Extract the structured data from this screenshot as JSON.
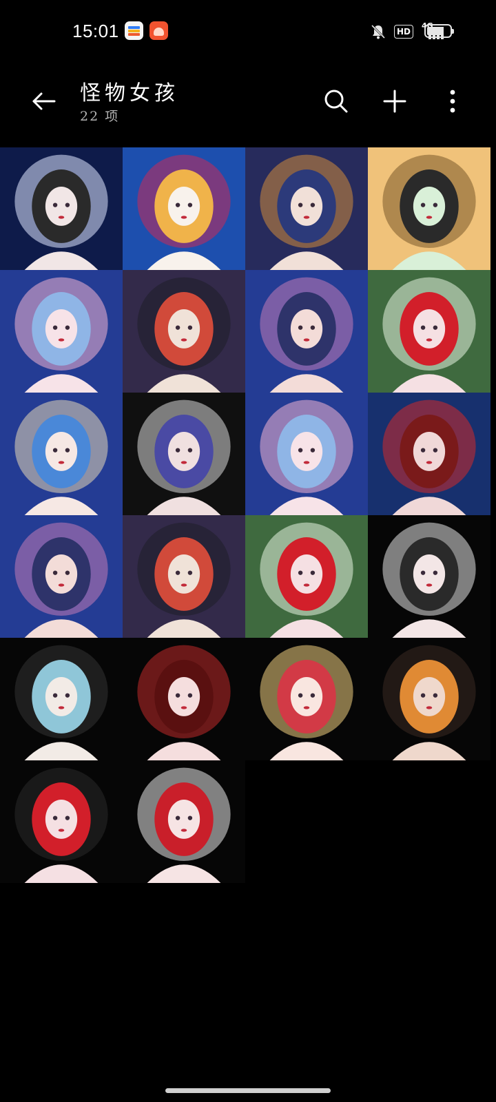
{
  "status_bar": {
    "time": "15:01",
    "icons": [
      "wallet-app-icon",
      "orange-app-icon",
      "mute-icon",
      "hd-icon",
      "4g-signal-icon",
      "battery-icon"
    ],
    "hd_label": "HD",
    "network_label": "4G"
  },
  "header": {
    "title": "怪物女孩",
    "subtitle": "22 项",
    "icons": [
      "back-arrow-icon",
      "search-icon",
      "plus-icon",
      "more-vertical-icon"
    ]
  },
  "gallery": {
    "count": 22,
    "columns": 4,
    "items": [
      {
        "palette": [
          "#0e1b4a",
          "#dfe6ff",
          "#2a2a2a",
          "#f1e6e6"
        ]
      },
      {
        "palette": [
          "#1d4fae",
          "#c82a58",
          "#f0b34a",
          "#f8f2ec"
        ]
      },
      {
        "palette": [
          "#272b5c",
          "#d08a3a",
          "#2c3a7a",
          "#f1e0d8"
        ]
      },
      {
        "palette": [
          "#f0c27a",
          "#7a5a2a",
          "#2a2a2a",
          "#d9f0d8"
        ]
      },
      {
        "palette": [
          "#243c94",
          "#f2b3cf",
          "#8fb5e6",
          "#f7e3e8"
        ]
      },
      {
        "palette": [
          "#332a4a",
          "#1e1e28",
          "#d14a3a",
          "#f0e2d8"
        ]
      },
      {
        "palette": [
          "#243c94",
          "#c27ab4",
          "#2e336a",
          "#f3dcd8"
        ]
      },
      {
        "palette": [
          "#3f6a3f",
          "#e6f2e0",
          "#d21f2a",
          "#f5e0e3"
        ]
      },
      {
        "palette": [
          "#243c94",
          "#e6d7b4",
          "#4a88d8",
          "#f6e8e4"
        ]
      },
      {
        "palette": [
          "#101010",
          "#d7d7d7",
          "#4a4aa4",
          "#f0e0e0"
        ]
      },
      {
        "palette": [
          "#243c94",
          "#f2b3cf",
          "#8fb5e6",
          "#f7e3e8"
        ]
      },
      {
        "palette": [
          "#17306e",
          "#d22a2a",
          "#7a1a1a",
          "#f0d8d8"
        ]
      },
      {
        "palette": [
          "#243c94",
          "#c27ab4",
          "#2e336a",
          "#f3dcd8"
        ]
      },
      {
        "palette": [
          "#332a4a",
          "#1e1e28",
          "#d14a3a",
          "#f0e2d8"
        ]
      },
      {
        "palette": [
          "#3f6a3f",
          "#e6f2e0",
          "#d21f2a",
          "#f5e0e3"
        ]
      },
      {
        "palette": [
          "#060606",
          "#e4e4e4",
          "#2a2a2a",
          "#f3e6e6"
        ]
      },
      {
        "palette": [
          "#060606",
          "#333333",
          "#8fc6d8",
          "#f2ebe6"
        ]
      },
      {
        "palette": [
          "#060606",
          "#c02a2a",
          "#5a1010",
          "#f5dede"
        ]
      },
      {
        "palette": [
          "#060606",
          "#f0d080",
          "#d23a46",
          "#f9e6e0"
        ]
      },
      {
        "palette": [
          "#060606",
          "#3a2a22",
          "#e08a34",
          "#efd8cc"
        ]
      },
      {
        "palette": [
          "#060606",
          "#2a2a2a",
          "#d21f2a",
          "#f5e0e3"
        ]
      },
      {
        "palette": [
          "#060606",
          "#e8e8e8",
          "#c91f2a",
          "#f6e4e4"
        ]
      }
    ]
  }
}
